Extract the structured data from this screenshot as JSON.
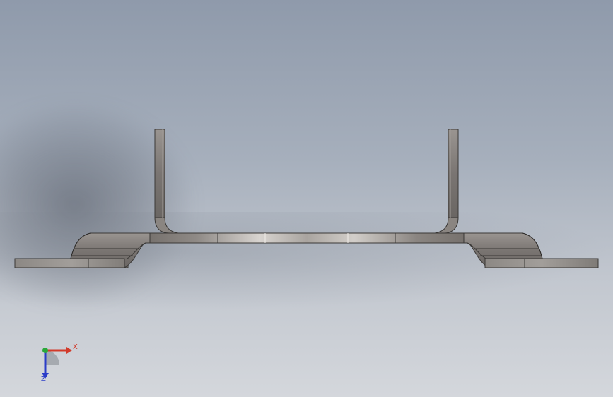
{
  "view": {
    "background_top": "#8f9aab",
    "background_bottom": "#d4d7dc"
  },
  "part": {
    "face_color_light": "#d8d4d0",
    "face_color_dark": "#6e6a66",
    "edge_color": "#3a3836"
  },
  "triad": {
    "x_label": "X",
    "z_label": "Z",
    "x_color": "#d23a2a",
    "y_color": "#2aa83a",
    "z_color": "#2a3cc8"
  }
}
